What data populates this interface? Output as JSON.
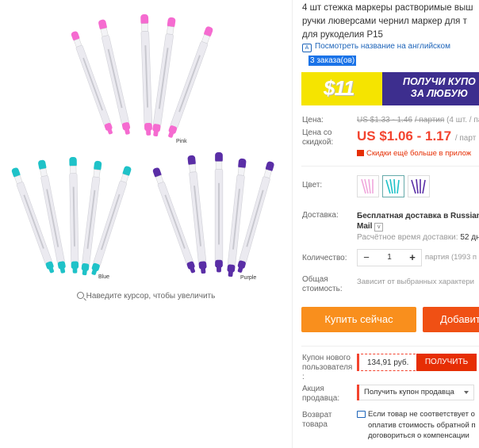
{
  "gallery": {
    "labels": {
      "pink": "Pink",
      "blue": "Blue",
      "purple": "Purple"
    },
    "zoom_hint": "Наведите курсор, чтобы увеличить",
    "colors": {
      "pink": "#f56bd0",
      "blue": "#1fc2c8",
      "purple": "#5a2ea6",
      "pen_body": "#e9e8ef"
    }
  },
  "product": {
    "title_lines": [
      "4 шт стежка маркеры растворимые выш",
      "ручки люверсами чернил маркер для т",
      "для рукоделия P15"
    ],
    "translate_link": "Посмотреть название на английском",
    "orders": "3 заказа(ов)"
  },
  "banner": {
    "amount": "$11",
    "line1": "ПОЛУЧИ КУПО",
    "line2": "ЗА ЛЮБУЮ"
  },
  "price": {
    "label": "Цена:",
    "old_price": "US $1.33 - 1.46",
    "old_unit": "/ партия",
    "old_extra": "(4 шт. / па",
    "discount_label_1": "Цена со",
    "discount_label_2": "скидкой:",
    "new_price": "US $1.06 - 1.17",
    "new_unit": "/ парт",
    "promo": "Скидки ещё больше в прилож"
  },
  "color": {
    "label": "Цвет:"
  },
  "shipping": {
    "label": "Доставка:",
    "line1": "Бесплатная доставка в Russian",
    "line2": "Mail",
    "time_label": "Расчётное время доставки:",
    "time_value": "52 дн"
  },
  "quantity": {
    "label": "Количество:",
    "value": "1",
    "minus": "−",
    "plus": "+",
    "note": "партия (1993 п"
  },
  "total": {
    "label_1": "Общая",
    "label_2": "стоимость:",
    "note": "Зависит от выбранных характери"
  },
  "buttons": {
    "buy": "Купить сейчас",
    "cart": "Добавит"
  },
  "coupon": {
    "label_1": "Купон нового",
    "label_2": "пользователя",
    "label_3": ":",
    "value": "134,91 руб.",
    "button": "ПОЛУЧИТЬ"
  },
  "seller": {
    "label_1": "Акция",
    "label_2": "продавца:",
    "select": "Получить купон продавца"
  },
  "returns": {
    "label_1": "Возврат",
    "label_2": "товара",
    "line1": "Если товар не соответствует о",
    "line2": "оплатив стоимость обратной п",
    "line3": "договориться о компенсации"
  }
}
